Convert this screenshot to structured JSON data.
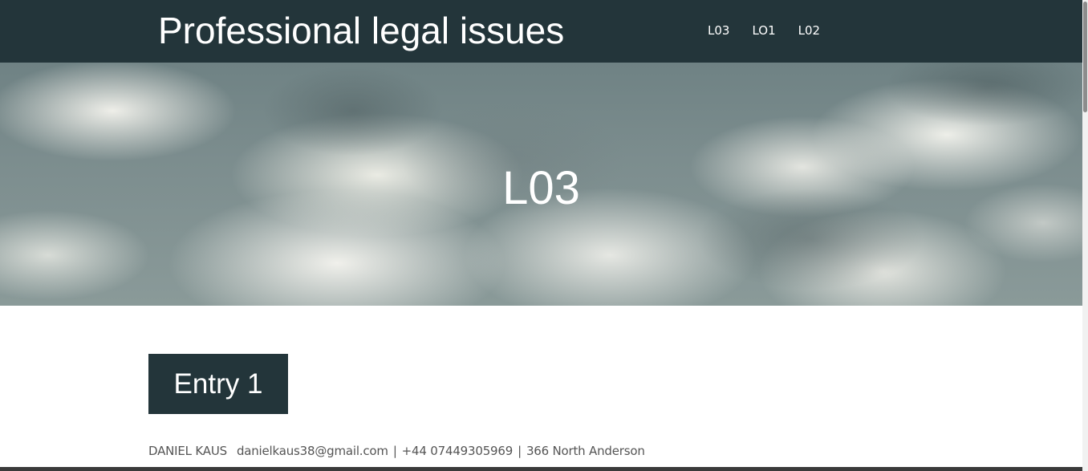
{
  "header": {
    "site_title": "Professional legal issues",
    "nav": [
      {
        "label": "L03"
      },
      {
        "label": "LO1"
      },
      {
        "label": "L02"
      }
    ]
  },
  "hero": {
    "title": "L03"
  },
  "main": {
    "entry_title": "Entry 1",
    "contact": {
      "name": "DANIEL KAUS",
      "email": "danielkaus38@gmail.com",
      "phone": "+44 07449305969",
      "address": "366 North Anderson",
      "separator": "|"
    }
  },
  "colors": {
    "header_bg": "#23353a",
    "badge_bg": "#23353a",
    "text_light": "#ffffff",
    "contact_text": "#555555"
  }
}
